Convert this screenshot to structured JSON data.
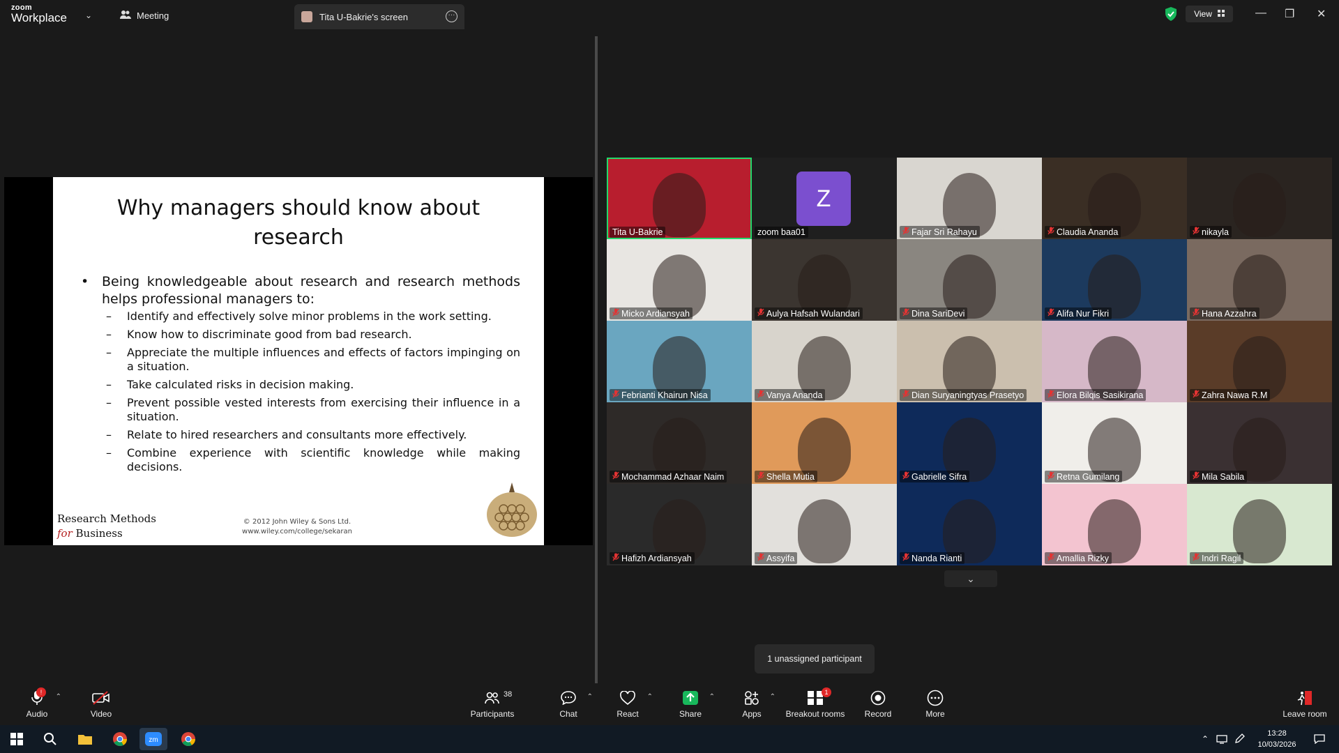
{
  "app": {
    "logo_line1": "zoom",
    "logo_line2": "Workplace"
  },
  "titlebar": {
    "meeting_label": "Meeting",
    "screen_tab_label": "Tita U-Bakrie's screen",
    "view_label": "View"
  },
  "slide": {
    "title_line1": "Why managers should know about",
    "title_line2": "research",
    "bullet": "Being knowledgeable about research and research methods helps professional managers to:",
    "subs": [
      "Identify and effectively solve minor problems in the work setting.",
      "Know how to discriminate good from bad research.",
      "Appreciate the multiple influences and effects of factors impinging on a situation.",
      "Take calculated risks in decision making.",
      "Prevent possible vested interests from exercising their influence in a situation.",
      "Relate to hired researchers and consultants more effectively.",
      "Combine experience with scientific knowledge while making decisions."
    ],
    "footer_left_line1": "Research Methods",
    "footer_left_for": "for",
    "footer_left_business": " Business",
    "footer_mid_line1": "© 2012 John Wiley & Sons Ltd.",
    "footer_mid_line2": "www.wiley.com/college/sekaran"
  },
  "gallery": {
    "participants": [
      {
        "name": "Tita U-Bakrie",
        "muted": false,
        "active": true
      },
      {
        "name": "zoom baa01",
        "muted": false,
        "avatar_letter": "Z"
      },
      {
        "name": "Fajar Sri Rahayu",
        "muted": true
      },
      {
        "name": "Claudia Ananda",
        "muted": true
      },
      {
        "name": "nikayla",
        "muted": true
      },
      {
        "name": "Micko Ardiansyah",
        "muted": true
      },
      {
        "name": "Aulya Hafsah Wulandari",
        "muted": true
      },
      {
        "name": "Dina SariDevi",
        "muted": true
      },
      {
        "name": "Alifa Nur Fikri",
        "muted": true
      },
      {
        "name": "Hana Azzahra",
        "muted": true
      },
      {
        "name": "Febrianti Khairun Nisa",
        "muted": true
      },
      {
        "name": "Vanya Ananda",
        "muted": true
      },
      {
        "name": "Dian Suryaningtyas Prasetyo",
        "muted": true
      },
      {
        "name": "Elora Bilqis Sasikirana",
        "muted": true
      },
      {
        "name": "Zahra Nawa R.M",
        "muted": true
      },
      {
        "name": "Mochammad Azhaar Naim",
        "muted": true
      },
      {
        "name": "Shella Mutia",
        "muted": true
      },
      {
        "name": "Gabrielle Sifra",
        "muted": true
      },
      {
        "name": "Retna Gumilang",
        "muted": true
      },
      {
        "name": "Mila Sabila",
        "muted": true
      },
      {
        "name": "Hafizh Ardiansyah",
        "muted": true
      },
      {
        "name": "Assyifa",
        "muted": true
      },
      {
        "name": "Nanda Rianti",
        "muted": true
      },
      {
        "name": "Amallia Rizky",
        "muted": true
      },
      {
        "name": "Indri Ragil",
        "muted": true
      }
    ],
    "tile_colors": [
      "#b81e2e",
      "#1f1f1f",
      "#d9d6d0",
      "#3a2e24",
      "#2a2420",
      "#e8e6e2",
      "#3b3530",
      "#8a8680",
      "#1c3a5e",
      "#7a6a60",
      "#6aa6c0",
      "#d8d4cc",
      "#cbbfae",
      "#d6b8c8",
      "#5a3c28",
      "#2e2a28",
      "#e09a5a",
      "#0e2a5a",
      "#f0eeea",
      "#3a3032",
      "#2a2a2a",
      "#e2e0dc",
      "#0e2a5a",
      "#f3c4d0",
      "#d8e8d0"
    ],
    "unassigned_tooltip": "1 unassigned participant"
  },
  "toolbar": {
    "audio": "Audio",
    "video": "Video",
    "participants": "Participants",
    "participants_count": "38",
    "chat": "Chat",
    "react": "React",
    "share": "Share",
    "apps": "Apps",
    "breakout": "Breakout rooms",
    "breakout_badge": "1",
    "record": "Record",
    "more": "More",
    "leave": "Leave room",
    "audio_badge": "!"
  },
  "taskbar": {
    "time": "13:28",
    "date": "10/03/2026"
  },
  "colors": {
    "share_green": "#18b85c",
    "active_outline": "#23d96b",
    "avatar_purple": "#7b4fcf",
    "muted_red": "#e33333"
  }
}
